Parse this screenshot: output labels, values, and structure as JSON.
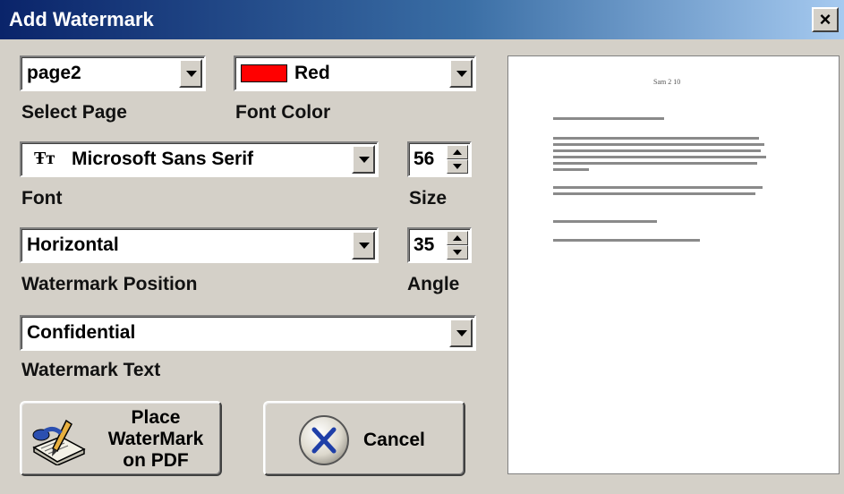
{
  "window": {
    "title": "Add Watermark",
    "close_glyph": "×"
  },
  "page_select": {
    "value": "page2",
    "label": "Select Page"
  },
  "font_color": {
    "value": "Red",
    "label": "Font Color",
    "swatch": "#ff0000"
  },
  "font": {
    "value": "Microsoft Sans Serif",
    "label": "Font",
    "icon": "truetype-font-icon",
    "icon_glyph": "Ŧт"
  },
  "size": {
    "value": "56",
    "label": "Size"
  },
  "position": {
    "value": "Horizontal",
    "label": "Watermark Position"
  },
  "angle": {
    "value": "35",
    "label": "Angle"
  },
  "text": {
    "value": "Confidential",
    "label": "Watermark Text"
  },
  "buttons": {
    "place": {
      "line1": "Place",
      "line2": "WaterMark",
      "line3": "on PDF",
      "icon": "pen-writing-icon"
    },
    "cancel": {
      "label": "Cancel",
      "icon": "x-circle-icon"
    }
  },
  "preview": {
    "heading": "Sam 2 10"
  }
}
